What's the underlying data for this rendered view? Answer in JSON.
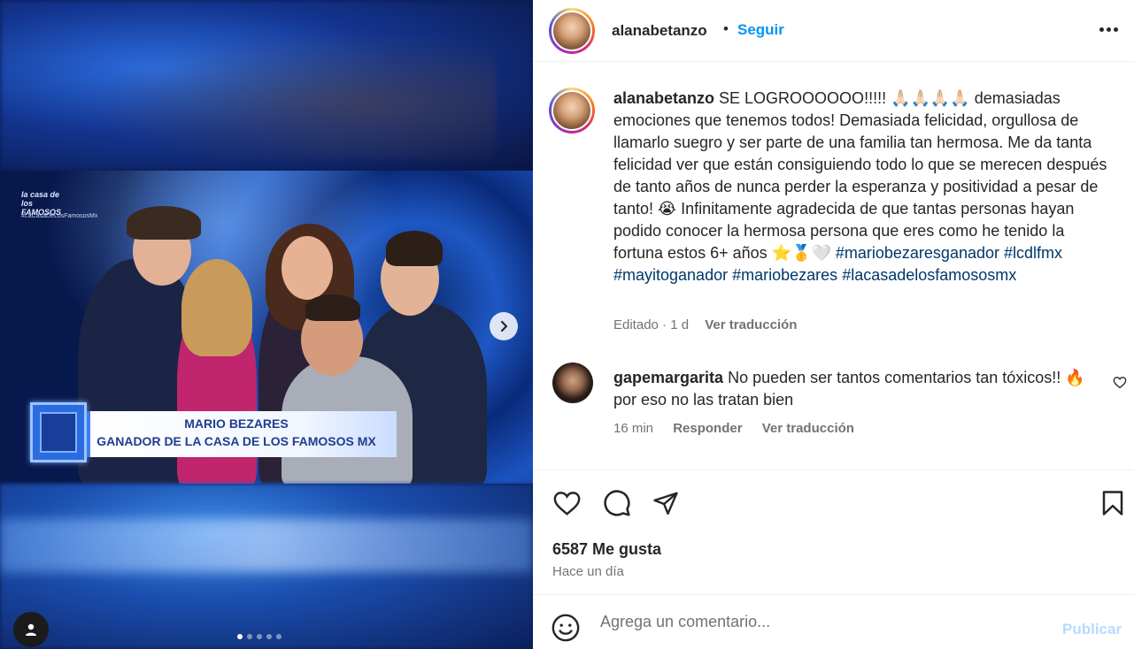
{
  "post": {
    "username": "alanabetanzo",
    "separator": "•",
    "follow_label": "Seguir",
    "more_icon": "more-options-icon"
  },
  "media": {
    "tv_logo": "la casa de los FAMOSOS",
    "tv_hashtag": "#LaCasaDeLosFamososMx",
    "lower_third_name": "MARIO BEZARES",
    "lower_third_title": "GANADOR DE LA CASA DE LOS FAMOSOS MX",
    "slide_count": 5,
    "active_slide": 1
  },
  "caption": {
    "username": "alanabetanzo",
    "text": " SE LOGROOOOOO!!!!! 🙏🏻🙏🏻🙏🏻🙏🏻 demasiadas emociones que tenemos todos! Demasiada felicidad, orgullosa de llamarlo suegro y ser parte de una familia tan hermosa. Me da tanta felicidad ver que están consiguiendo todo lo que se merecen después de tanto años de nunca perder la esperanza y positividad a pesar de tanto! 😭 Infinitamente agradecida de que tantas personas hayan podido conocer la hermosa persona que eres como he tenido la fortuna estos 6+ años ⭐🥇🤍",
    "hashtags": [
      "#mariobezaresganador",
      "#lcdlfmx",
      "#mayitoganador",
      "#mariobezares",
      "#lacasadelosfamososmx"
    ],
    "edited": "Editado",
    "dot": "·",
    "age": "1 d",
    "translate": "Ver traducción"
  },
  "comment": {
    "username": "gapemargarita",
    "text": " No pueden ser tantos comentarios tan tóxicos!! 🔥por eso no las tratan bien",
    "age": "16 min",
    "reply": "Responder",
    "translate": "Ver traducción"
  },
  "actions": {
    "likes": "6587 Me gusta",
    "posted": "Hace un día"
  },
  "composer": {
    "placeholder": "Agrega un comentario...",
    "publish": "Publicar"
  }
}
